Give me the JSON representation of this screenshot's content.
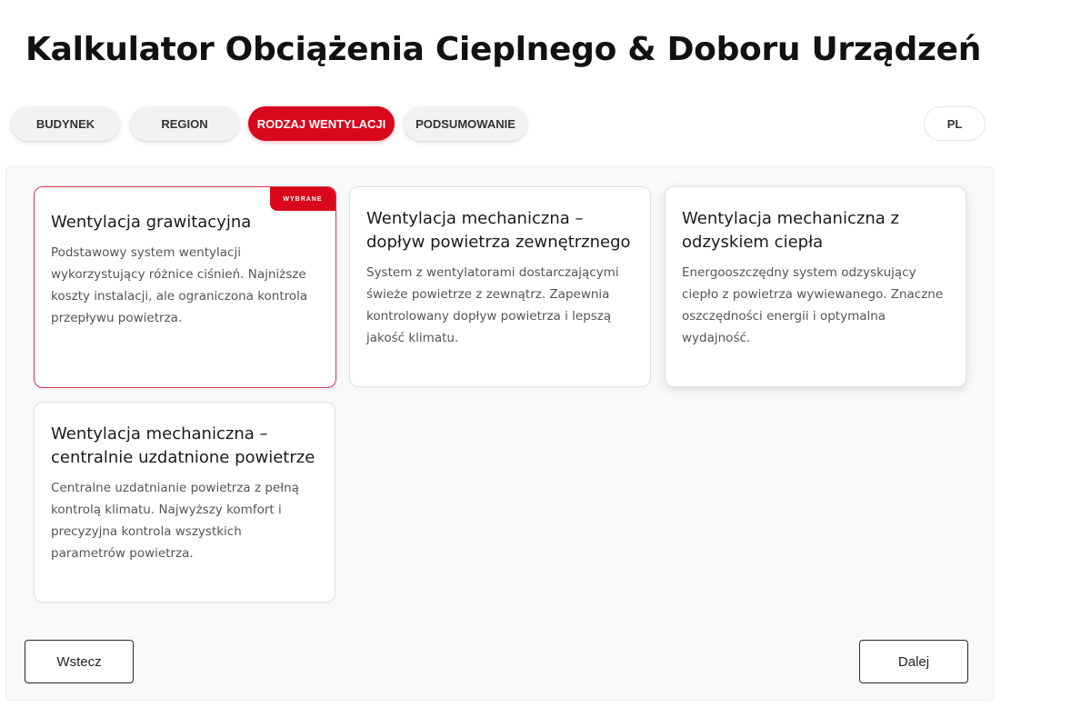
{
  "header": {
    "title": "Kalkulator Obciążenia Cieplnego & Doboru Urządzeń"
  },
  "steps": {
    "items": [
      {
        "label": "BUDYNEK",
        "active": false
      },
      {
        "label": "REGION",
        "active": false
      },
      {
        "label": "RODZAJ WENTYLACJI",
        "active": true
      },
      {
        "label": "PODSUMOWANIE",
        "active": false
      }
    ],
    "language": "PL"
  },
  "options": {
    "selected_badge": "WYBRANE",
    "cards": [
      {
        "title": "Wentylacja grawitacyjna",
        "description": "Podstawowy system wentylacji wykorzystujący różnice ciśnień. Najniższe koszty instalacji, ale ograniczona kontrola przepływu powietrza.",
        "selected": true
      },
      {
        "title": "Wentylacja mechaniczna – dopływ powietrza zewnętrznego",
        "description": "System z wentylatorami dostarczającymi świeże powietrze z zewnątrz. Zapewnia kontrolowany dopływ powietrza i lepszą jakość klimatu.",
        "selected": false
      },
      {
        "title": "Wentylacja mechaniczna z odzyskiem ciepła",
        "description": "Energooszczędny system odzyskujący ciepło z powietrza wywiewanego. Znaczne oszczędności energii i optymalna wydajność.",
        "selected": false
      },
      {
        "title": "Wentylacja mechaniczna – centralnie uzdatnione powietrze",
        "description": "Centralne uzdatnianie powietrza z pełną kontrolą klimatu. Najwyższy komfort i precyzyjna kontrola wszystkich parametrów powietrza.",
        "selected": false
      }
    ]
  },
  "navigation": {
    "back_label": "Wstecz",
    "next_label": "Dalej"
  },
  "colors": {
    "accent": "#d9071b",
    "selected_border": "#d9374a",
    "panel_bg": "#f8f9fb"
  }
}
